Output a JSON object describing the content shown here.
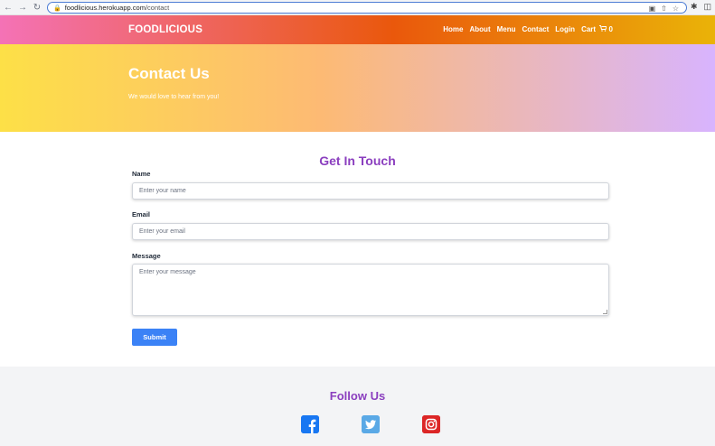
{
  "browser": {
    "url_host": "foodlicious.herokuapp.com",
    "url_path": "/contact"
  },
  "navbar": {
    "brand": "FOODLICIOUS",
    "links": [
      "Home",
      "About",
      "Menu",
      "Contact",
      "Login"
    ],
    "cart_label": "Cart",
    "cart_count": "0"
  },
  "hero": {
    "title": "Contact Us",
    "subtitle": "We would love to hear from you!"
  },
  "form": {
    "title": "Get In Touch",
    "name_label": "Name",
    "name_placeholder": "Enter your name",
    "email_label": "Email",
    "email_placeholder": "Enter your email",
    "message_label": "Message",
    "message_placeholder": "Enter your message",
    "submit_label": "Submit"
  },
  "footer": {
    "title": "Follow Us",
    "socials": [
      "facebook-icon",
      "twitter-icon",
      "instagram-icon"
    ]
  },
  "colors": {
    "accent": "#8b3fbf",
    "button": "#3b82f6"
  }
}
